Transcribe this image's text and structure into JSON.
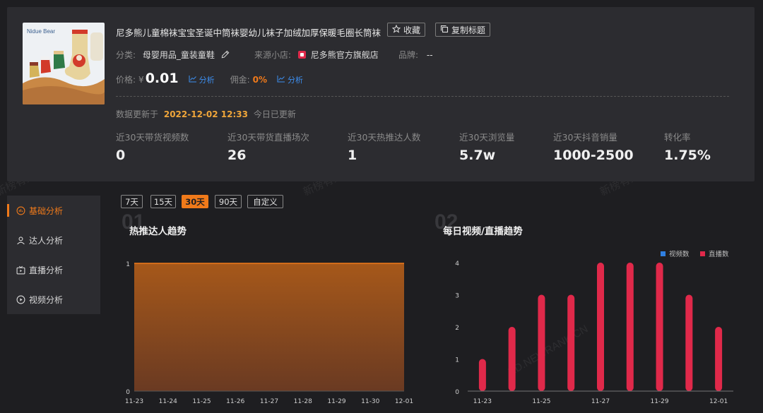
{
  "product": {
    "title": "尼多熊儿童棉袜宝宝圣诞中筒袜婴幼儿袜子加绒加厚保暖毛圈长筒袜",
    "thumb_text": "Nidue Bear",
    "favorite_label": "收藏",
    "copy_title_label": "复制标题",
    "category_label": "分类:",
    "category_value": "母婴用品_童装童鞋",
    "shop_label": "来源小店:",
    "shop_value": "尼多熊官方旗舰店",
    "brand_label": "品牌:",
    "brand_value": "--",
    "price_label": "价格:",
    "price_currency": "¥",
    "price_value": "0.01",
    "price_analyze": "分析",
    "commission_label": "佣金:",
    "commission_value": "0%",
    "commission_analyze": "分析",
    "update_prefix": "数据更新于",
    "update_time": "2022-12-02 12:33",
    "update_suffix": "今日已更新"
  },
  "stats": [
    {
      "label": "近30天带货视频数",
      "value": "0"
    },
    {
      "label": "近30天带货直播场次",
      "value": "26"
    },
    {
      "label": "近30天热推达人数",
      "value": "1"
    },
    {
      "label": "近30天浏览量",
      "value": "5.7w"
    },
    {
      "label": "近30天抖音销量",
      "value": "1000-2500"
    },
    {
      "label": "转化率",
      "value": "1.75%"
    }
  ],
  "sidebar": {
    "items": [
      {
        "label": "基础分析",
        "icon": "basic-analysis-icon"
      },
      {
        "label": "达人分析",
        "icon": "user-icon"
      },
      {
        "label": "直播分析",
        "icon": "live-tv-icon"
      },
      {
        "label": "视频分析",
        "icon": "play-circle-icon"
      }
    ]
  },
  "tabs": [
    "7天",
    "15天",
    "30天",
    "90天",
    "自定义"
  ],
  "watermarks": [
    "XD.NEWRANK.CN",
    "新榜有数 · 新抖"
  ],
  "colors": {
    "accent": "#f07a1a",
    "link": "#3d8ff0",
    "bar": "#e0294a",
    "video": "#2f7fe0",
    "highlight": "#f0a63a"
  },
  "section1": {
    "num": "01",
    "title": "热推达人趋势"
  },
  "section2": {
    "num": "02",
    "title": "每日视频/直播趋势"
  },
  "chart_data": [
    {
      "type": "area",
      "title": "热推达人趋势",
      "x": [
        "11-23",
        "11-24",
        "11-25",
        "11-26",
        "11-27",
        "11-28",
        "11-29",
        "11-30",
        "12-01"
      ],
      "values": [
        1,
        1,
        1,
        1,
        1,
        1,
        1,
        1,
        1
      ],
      "ylim": [
        0,
        1
      ],
      "yticks": [
        0,
        1
      ]
    },
    {
      "type": "bar",
      "title": "每日视频/直播趋势",
      "categories": [
        "11-23",
        "11-24",
        "11-25",
        "11-26",
        "11-27",
        "11-28",
        "11-29",
        "11-30",
        "12-01"
      ],
      "xtick_labels": [
        "11-23",
        "11-25",
        "11-27",
        "11-29",
        "12-01"
      ],
      "series": [
        {
          "name": "视频数",
          "values": [
            0,
            0,
            0,
            0,
            0,
            0,
            0,
            0,
            0
          ]
        },
        {
          "name": "直播数",
          "values": [
            1,
            2,
            3,
            3,
            4,
            4,
            4,
            3,
            2
          ]
        }
      ],
      "ylim": [
        0,
        4
      ],
      "yticks": [
        0,
        1,
        2,
        3,
        4
      ],
      "legend": "top-right"
    }
  ]
}
